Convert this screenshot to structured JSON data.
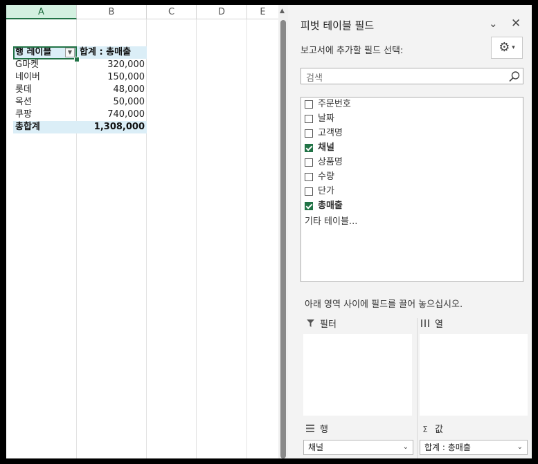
{
  "sheet": {
    "columns": [
      "A",
      "B",
      "C",
      "D",
      "E"
    ],
    "pivot": {
      "row_label_header": "행 레이블",
      "value_header": "합계 : 총매출",
      "rows": [
        {
          "label": "G마켓",
          "value": "320,000"
        },
        {
          "label": "네이버",
          "value": "150,000"
        },
        {
          "label": "롯데",
          "value": "48,000"
        },
        {
          "label": "옥션",
          "value": "50,000"
        },
        {
          "label": "쿠팡",
          "value": "740,000"
        }
      ],
      "total_label": "총합계",
      "total_value": "1,308,000"
    }
  },
  "panel": {
    "title": "피벗 테이블 필드",
    "choose_fields_label": "보고서에 추가할 필드 선택:",
    "search_placeholder": "검색",
    "fields": [
      {
        "label": "주문번호",
        "checked": false
      },
      {
        "label": "날짜",
        "checked": false
      },
      {
        "label": "고객명",
        "checked": false
      },
      {
        "label": "채널",
        "checked": true
      },
      {
        "label": "상품명",
        "checked": false
      },
      {
        "label": "수량",
        "checked": false
      },
      {
        "label": "단가",
        "checked": false
      },
      {
        "label": "총매출",
        "checked": true
      }
    ],
    "more_tables": "기타 테이블...",
    "drag_hint": "아래 영역 사이에 필드를 끌어 놓으십시오.",
    "areas": {
      "filter": {
        "label": "필터",
        "icon": "filter-icon"
      },
      "columns": {
        "label": "열",
        "icon": "columns-icon"
      },
      "rows": {
        "label": "행",
        "icon": "rows-icon",
        "item": "채널"
      },
      "values": {
        "label": "값",
        "icon": "sigma-icon",
        "item": "합계 : 총매출"
      }
    }
  },
  "colors": {
    "accent": "#217346",
    "pivot_header_fill": "#dbeef7",
    "panel_bg": "#f3f3f3"
  }
}
